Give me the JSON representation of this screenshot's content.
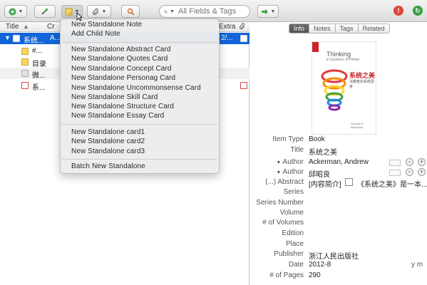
{
  "toolbar": {
    "search_placeholder": "All Fields & Tags"
  },
  "columns": {
    "title": "Title",
    "creator": "Cr",
    "extra": "Extra"
  },
  "items": [
    {
      "title": "系统...",
      "creator": "A...",
      "extra": "2/...",
      "selected": true
    },
    {
      "title": "#...",
      "creator": "",
      "extra": ""
    },
    {
      "title": "目录",
      "creator": "",
      "extra": ""
    },
    {
      "title": "微...",
      "creator": "",
      "extra": ""
    },
    {
      "title": "系...",
      "creator": "",
      "extra": ""
    }
  ],
  "menu": {
    "new_standalone_note": "New Standalone Note",
    "add_child_note": "Add Child Note",
    "cards": [
      "New Standalone Abstract Card",
      "New Standalone Quotes Card",
      "New Standalone Concept Card",
      "New Standalone Personag Card",
      "New Standalone Uncommonsense Card",
      "New Standalone Skill Card",
      "New Standalone Structure Card",
      "New Standalone Essay Card"
    ],
    "custom_cards": [
      "New Standalone card1",
      "New Standalone card2",
      "New Standalone card3"
    ],
    "batch": "Batch New Standalone"
  },
  "tabs": [
    "Info",
    "Notes",
    "Tags",
    "Related"
  ],
  "cover": {
    "title_en": "Thinking",
    "subtitle_en": "in Systems: A Primer",
    "title_cn": "系统之美",
    "subtitle_cn": "决策者的系统思考",
    "author_en": "Donella H. Meadows"
  },
  "fields": {
    "item_type_label": "Item Type",
    "item_type": "Book",
    "title_label": "Title",
    "title": "系统之美",
    "author_label": "Author",
    "author1": "Ackerman, Andrew",
    "author2": "邱昭良",
    "abstract_label": "(...) Abstract",
    "abstract": "[内容简介]",
    "abstract_cont": "《系统之美》是一本...",
    "series_label": "Series",
    "series_number_label": "Series Number",
    "volume_label": "Volume",
    "num_volumes_label": "# of Volumes",
    "edition_label": "Edition",
    "place_label": "Place",
    "publisher_label": "Publisher",
    "publisher": "浙江人民出版社",
    "date_label": "Date",
    "date": "2012-8",
    "date_ym": "y m",
    "pages_label": "# of Pages",
    "pages": "290"
  },
  "colors": {
    "selection": "#1264d8",
    "stop_red": "#d94a3a",
    "sync_green": "#3aa043"
  }
}
